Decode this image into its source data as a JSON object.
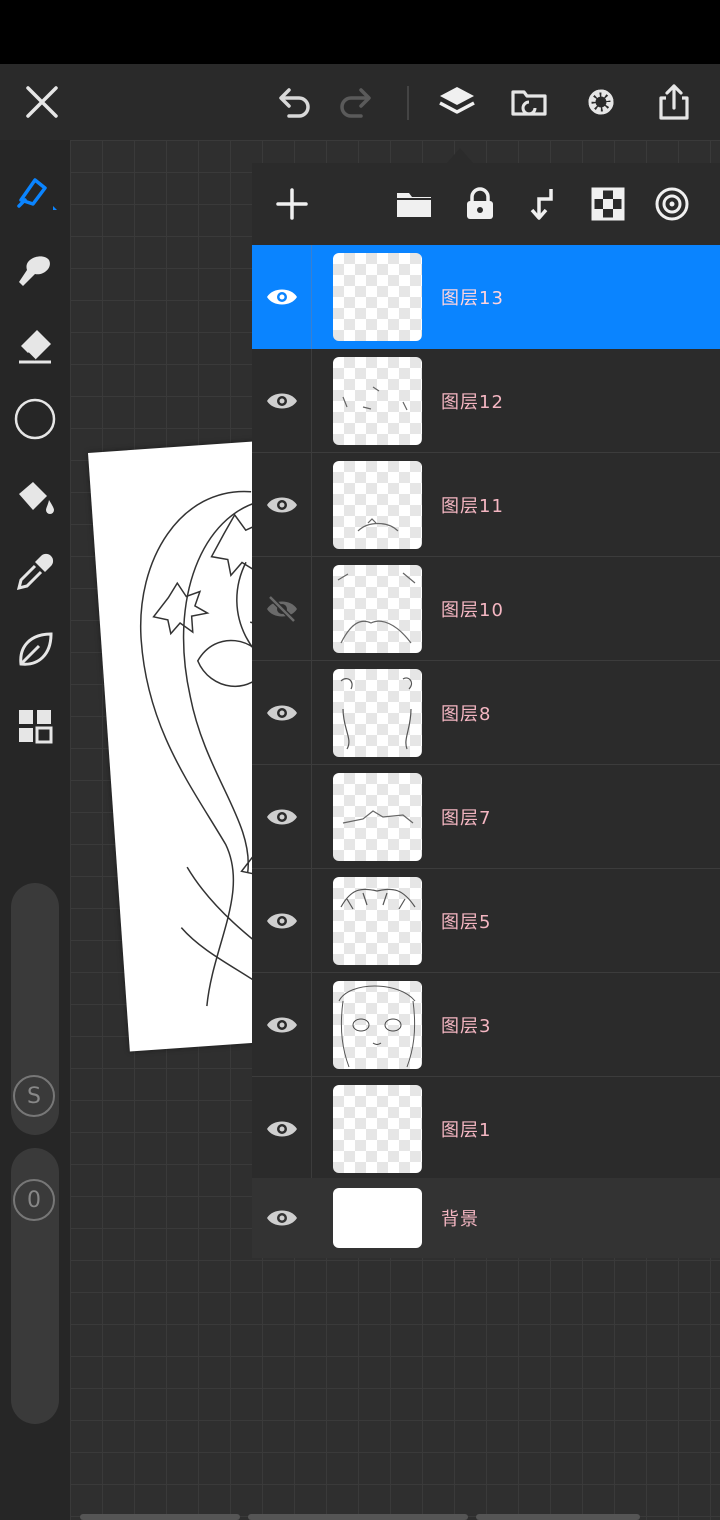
{
  "topbar": {
    "icons": [
      "close-icon",
      "undo-icon",
      "redo-icon",
      "layers-icon",
      "import-icon",
      "settings-icon",
      "share-icon"
    ]
  },
  "tools": [
    "brush-icon",
    "smudge-icon",
    "eraser-icon",
    "shape-icon",
    "fill-icon",
    "eyedropper-icon",
    "leaf-icon",
    "grid-icon"
  ],
  "sliders": {
    "top_badge": "S",
    "bottom_badge": "0"
  },
  "layers_panel": {
    "toolbar_icons": [
      "add-icon",
      "folder-icon",
      "lock-icon",
      "merge-down-icon",
      "transparency-icon",
      "blend-icon"
    ],
    "layers": [
      {
        "name": "图层13",
        "visible": true,
        "selected": true
      },
      {
        "name": "图层12",
        "visible": true,
        "selected": false
      },
      {
        "name": "图层11",
        "visible": true,
        "selected": false
      },
      {
        "name": "图层10",
        "visible": false,
        "selected": false
      },
      {
        "name": "图层8",
        "visible": true,
        "selected": false
      },
      {
        "name": "图层7",
        "visible": true,
        "selected": false
      },
      {
        "name": "图层5",
        "visible": true,
        "selected": false
      },
      {
        "name": "图层3",
        "visible": true,
        "selected": false
      },
      {
        "name": "图层1",
        "visible": true,
        "selected": false
      },
      {
        "name": "背景",
        "visible": true,
        "selected": false
      }
    ]
  },
  "colors": {
    "accent": "#0a84ff",
    "layer_name": "#f4b6c2"
  }
}
